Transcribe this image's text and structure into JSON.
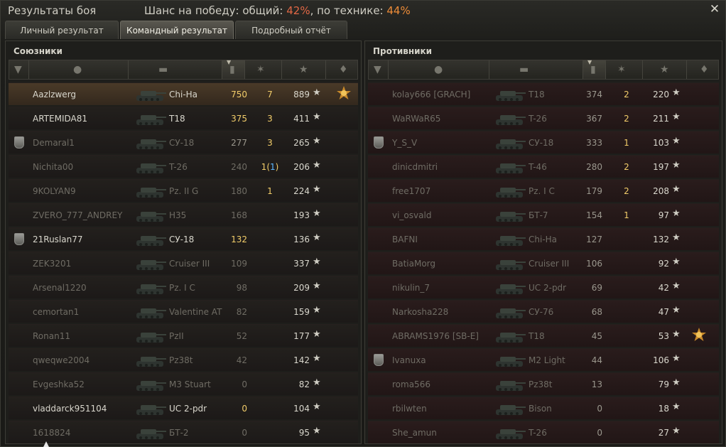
{
  "title": "Результаты боя",
  "chance": {
    "prefix": "Шанс на победу: общий: ",
    "overall": "42%",
    "mid": ", по технике: ",
    "tech": "44%"
  },
  "tabs": [
    {
      "label": "Личный результат"
    },
    {
      "label": "Командный результат"
    },
    {
      "label": "Подробный отчёт"
    }
  ],
  "allies": {
    "title": "Союзники",
    "rows": [
      {
        "name": "Aazlzwerg",
        "vehicle": "Chi-Ha",
        "damage": "750",
        "kills": "7",
        "xp": "889",
        "medal": "2"
      },
      {
        "name": "ARTEMIDA81",
        "vehicle": "T18",
        "damage": "375",
        "kills": "3",
        "xp": "411",
        "medal": ""
      },
      {
        "name": "Demaral1",
        "vehicle": "СУ-18",
        "damage": "277",
        "kills": "3",
        "xp": "265",
        "medal": ""
      },
      {
        "name": "Nichita00",
        "vehicle": "T-26",
        "damage": "240",
        "kills": "1",
        "kills_extra": "1",
        "xp": "206",
        "medal": ""
      },
      {
        "name": "9KOLYAN9",
        "vehicle": "Pz. II G",
        "damage": "180",
        "kills": "1",
        "xp": "224",
        "medal": ""
      },
      {
        "name": "ZVERO_777_ANDREY",
        "vehicle": "H35",
        "damage": "168",
        "kills": "",
        "xp": "193",
        "medal": ""
      },
      {
        "name": "21Ruslan77",
        "vehicle": "СУ-18",
        "damage": "132",
        "kills": "",
        "xp": "136",
        "medal": ""
      },
      {
        "name": "ZEK3201",
        "vehicle": "Cruiser III",
        "damage": "109",
        "kills": "",
        "xp": "337",
        "medal": ""
      },
      {
        "name": "Arsenal1220",
        "vehicle": "Pz. I C",
        "damage": "98",
        "kills": "",
        "xp": "209",
        "medal": ""
      },
      {
        "name": "cemortan1",
        "vehicle": "Valentine AT",
        "damage": "82",
        "kills": "",
        "xp": "159",
        "medal": ""
      },
      {
        "name": "Ronan11",
        "vehicle": "PzII",
        "damage": "52",
        "kills": "",
        "xp": "177",
        "medal": ""
      },
      {
        "name": "qweqwe2004",
        "vehicle": "Pz38t",
        "damage": "42",
        "kills": "",
        "xp": "142",
        "medal": ""
      },
      {
        "name": "Evgeshka52",
        "vehicle": "M3 Stuart",
        "damage": "0",
        "kills": "",
        "xp": "82",
        "medal": ""
      },
      {
        "name": "vladdarck951104",
        "vehicle": "UC 2-pdr",
        "damage": "0",
        "kills": "",
        "xp": "104",
        "medal": ""
      },
      {
        "name": "1618824",
        "vehicle": "БТ-2",
        "damage": "0",
        "kills": "",
        "xp": "95",
        "medal": ""
      }
    ]
  },
  "enemies": {
    "title": "Противники",
    "rows": [
      {
        "name": "kolay666 [GRACH]",
        "vehicle": "T18",
        "damage": "374",
        "kills": "2",
        "xp": "220",
        "medal": ""
      },
      {
        "name": "WaRWaR65",
        "vehicle": "T-26",
        "damage": "367",
        "kills": "2",
        "xp": "211",
        "medal": ""
      },
      {
        "name": "Y_S_V",
        "vehicle": "СУ-18",
        "damage": "333",
        "kills": "1",
        "xp": "103",
        "medal": ""
      },
      {
        "name": "dinicdmitri",
        "vehicle": "T-46",
        "damage": "280",
        "kills": "2",
        "xp": "197",
        "medal": ""
      },
      {
        "name": "free1707",
        "vehicle": "Pz. I C",
        "damage": "179",
        "kills": "2",
        "xp": "208",
        "medal": ""
      },
      {
        "name": "vi_osvald",
        "vehicle": "БТ-7",
        "damage": "154",
        "kills": "1",
        "xp": "97",
        "medal": ""
      },
      {
        "name": "BAFNI",
        "vehicle": "Chi-Ha",
        "damage": "127",
        "kills": "",
        "xp": "132",
        "medal": ""
      },
      {
        "name": "BatiaMorg",
        "vehicle": "Cruiser III",
        "damage": "106",
        "kills": "",
        "xp": "92",
        "medal": ""
      },
      {
        "name": "nikulin_7",
        "vehicle": "UC 2-pdr",
        "damage": "69",
        "kills": "",
        "xp": "42",
        "medal": ""
      },
      {
        "name": "Narkosha228",
        "vehicle": "СУ-76",
        "damage": "68",
        "kills": "",
        "xp": "47",
        "medal": ""
      },
      {
        "name": "ABRAMS1976 [SB-E]",
        "vehicle": "T18",
        "damage": "45",
        "kills": "",
        "xp": "53",
        "medal": "medal"
      },
      {
        "name": "Ivanuxa",
        "vehicle": "M2 Light",
        "damage": "44",
        "kills": "",
        "xp": "106",
        "medal": ""
      },
      {
        "name": "roma566",
        "vehicle": "Pz38t",
        "damage": "13",
        "kills": "",
        "xp": "79",
        "medal": ""
      },
      {
        "name": "rbilwten",
        "vehicle": "Bison",
        "damage": "0",
        "kills": "",
        "xp": "18",
        "medal": ""
      },
      {
        "name": "She_amun",
        "vehicle": "T-26",
        "damage": "0",
        "kills": "",
        "xp": "27",
        "medal": ""
      }
    ]
  },
  "colors": {
    "overall": "#e06745",
    "tech": "#ee8c38",
    "kills": "#f2cd6a",
    "assist": "#5cb7ff"
  }
}
